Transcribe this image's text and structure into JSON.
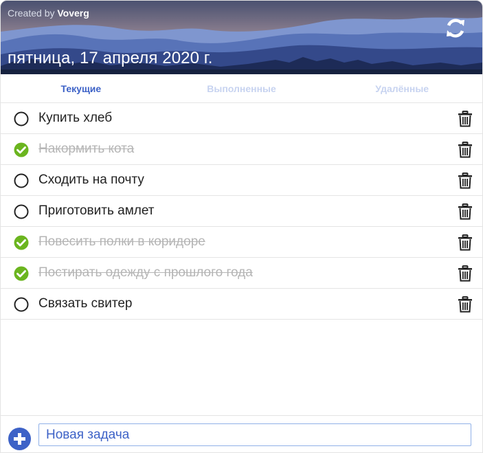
{
  "header": {
    "credit_prefix": "Created by",
    "credit_author": "Voverg",
    "date": "пятница, 17 апреля 2020 г.",
    "refresh_icon": "refresh-icon"
  },
  "tabs": [
    {
      "label": "Текущие",
      "active": true
    },
    {
      "label": "Выполненные",
      "active": false
    },
    {
      "label": "Удалённые",
      "active": false
    }
  ],
  "tasks": [
    {
      "text": "Купить хлеб",
      "done": false
    },
    {
      "text": "Накормить кота",
      "done": true
    },
    {
      "text": "Сходить на почту",
      "done": false
    },
    {
      "text": "Приготовить амлет",
      "done": false
    },
    {
      "text": "Повесить полки в коридоре",
      "done": true
    },
    {
      "text": "Постирать одежду с прошлого года",
      "done": true
    },
    {
      "text": "Связать свитер",
      "done": false
    }
  ],
  "footer": {
    "input_placeholder": "Новая задача",
    "input_value": "",
    "add_icon": "plus-circle-icon"
  },
  "colors": {
    "accent": "#3d62c7",
    "done_check": "#6bb51f",
    "tab_inactive": "#c7d3f0"
  }
}
